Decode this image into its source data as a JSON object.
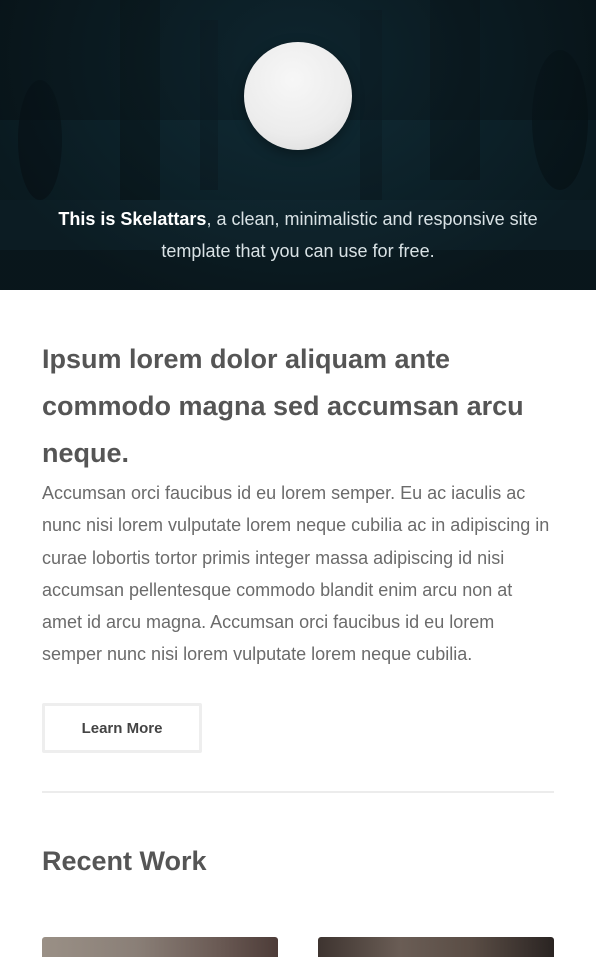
{
  "hero": {
    "intro_strong": "This is Skelattars",
    "intro_rest": ", a clean, minimalistic and responsive site template that you can use for free."
  },
  "main": {
    "headline": "Ipsum lorem dolor aliquam ante commodo magna sed accumsan arcu neque.",
    "body": "Accumsan orci faucibus id eu lorem semper. Eu ac iaculis ac nunc nisi lorem vulputate lorem neque cubilia ac in adipiscing in curae lobortis tortor primis integer massa adipiscing id nisi accumsan pellentesque commodo blandit enim arcu non at amet id arcu magna. Accumsan orci faucibus id eu lorem semper nunc nisi lorem vulputate lorem neque cubilia.",
    "button_label": "Learn More"
  },
  "recent_work": {
    "title": "Recent Work"
  },
  "colors": {
    "hero_bg": "#10303b",
    "text": "#555555",
    "border": "#eeeeee"
  }
}
